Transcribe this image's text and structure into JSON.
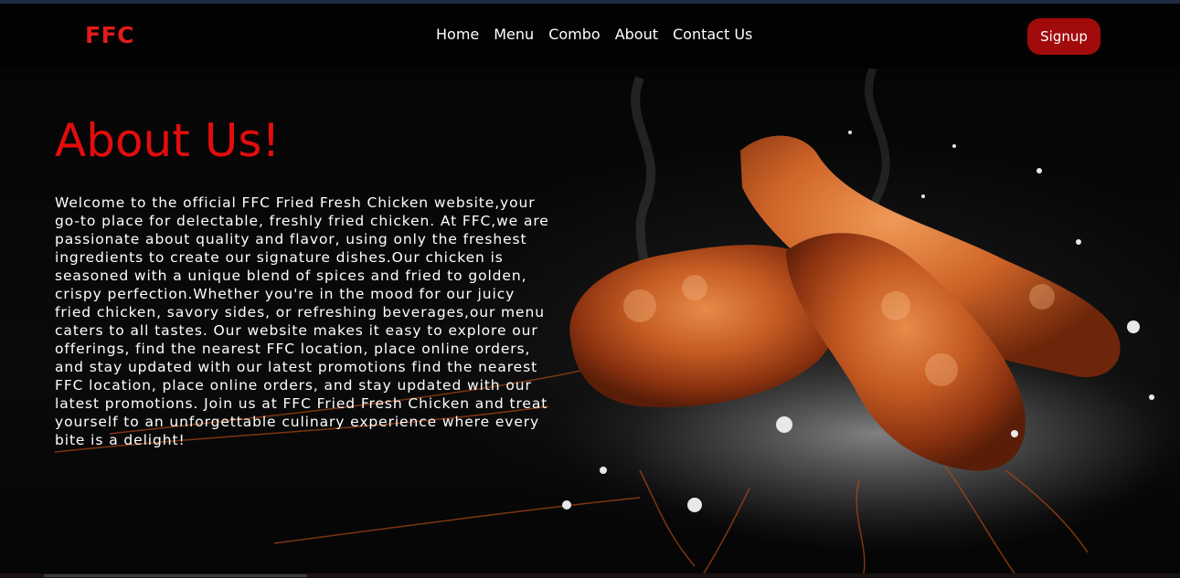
{
  "brand": {
    "logo": "FFC",
    "color": "#e01b1b"
  },
  "nav": {
    "items": [
      {
        "label": "Home"
      },
      {
        "label": "Menu"
      },
      {
        "label": "Combo"
      },
      {
        "label": "About"
      },
      {
        "label": "Contact Us"
      }
    ],
    "signup_label": "Signup"
  },
  "about": {
    "title": "About Us!",
    "body": "Welcome to the official FFC Fried Fresh Chicken website,your go-to place for delectable, freshly fried chicken. At FFC,we are passionate about quality and flavor, using only the freshest ingredients to create our signature dishes.Our chicken is seasoned with a unique blend of spices and fried to golden, crispy perfection.Whether you're in the mood for our juicy fried chicken, savory sides, or refreshing beverages,our menu caters to all tastes. Our website makes it easy to explore our offerings, find the nearest FFC location, place online orders, and stay updated with our latest promotions find the nearest FFC location, place online orders, and stay updated with our latest promotions. Join us at FFC Fried Fresh Chicken and treat yourself to an unforgettable culinary experience where every bite is a delight!"
  },
  "colors": {
    "accent": "#e30d0d",
    "button": "#a10b0b",
    "background": "#000000"
  }
}
